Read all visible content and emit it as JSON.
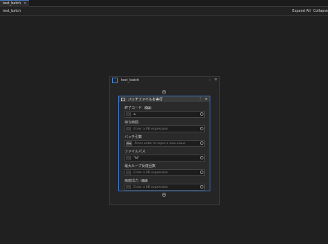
{
  "tabs": [
    {
      "label": "test_batch",
      "close": "×"
    }
  ],
  "header": {
    "breadcrumb": "test_batch",
    "expand_all": "Expand All",
    "collapse": "Collapse"
  },
  "sequence": {
    "title": "test_batch",
    "menu_dots": "⋮",
    "menu_collapse": "≡"
  },
  "activity": {
    "title": "バッチファイルを実行",
    "properties": [
      {
        "label": "終了コード",
        "badge": "Out",
        "button": "{}",
        "value": "a",
        "placeholder": ""
      },
      {
        "label": "待ち時間",
        "badge": "",
        "button": "{}",
        "value": "",
        "placeholder": "Enter a VB expression"
      },
      {
        "label": "バッチ引数",
        "badge": "",
        "button": "",
        "tag": "Abc",
        "value": "",
        "placeholder": "Press enter to input a new value"
      },
      {
        "label": "ファイルパス",
        "badge": "",
        "button": "{}",
        "value": "\"hi\"",
        "placeholder": ""
      },
      {
        "label": "最大ループ反復回数",
        "badge": "",
        "button": "{}",
        "value": "",
        "placeholder": "Enter a VB expression"
      },
      {
        "label": "画面出力",
        "badge": "Out",
        "button": "{}",
        "value": "",
        "placeholder": "Enter a VB expression"
      }
    ]
  },
  "icons": {
    "plus": "+",
    "menu": "⋮"
  }
}
